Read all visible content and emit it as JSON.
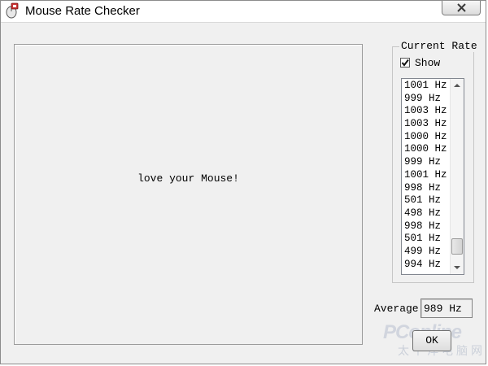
{
  "window": {
    "title": "Mouse Rate Checker"
  },
  "icons": {
    "app": "mouse-app-icon",
    "close": "close-icon",
    "check": "check-icon",
    "scroll_up": "chevron-up-icon",
    "scroll_down": "chevron-down-icon"
  },
  "canvas": {
    "message": "love your Mouse!"
  },
  "current_rate": {
    "group_label": "Current Rate",
    "show_label": "Show",
    "show_checked": true,
    "list": [
      "1001 Hz",
      "999 Hz",
      "1003 Hz",
      "1003 Hz",
      "1000 Hz",
      "1000 Hz",
      "999 Hz",
      "1001 Hz",
      "998 Hz",
      "501 Hz",
      "498 Hz",
      "998 Hz",
      "501 Hz",
      "499 Hz",
      "994 Hz"
    ]
  },
  "average": {
    "label": "Average",
    "value": "989 Hz"
  },
  "buttons": {
    "ok": "OK"
  },
  "watermark": {
    "brand": "PConline",
    "sub": "太平洋电脑网"
  },
  "colors": {
    "window_bg": "#f0f0f0",
    "titlebar_bg": "#ffffff",
    "list_bg": "#ffffff"
  }
}
